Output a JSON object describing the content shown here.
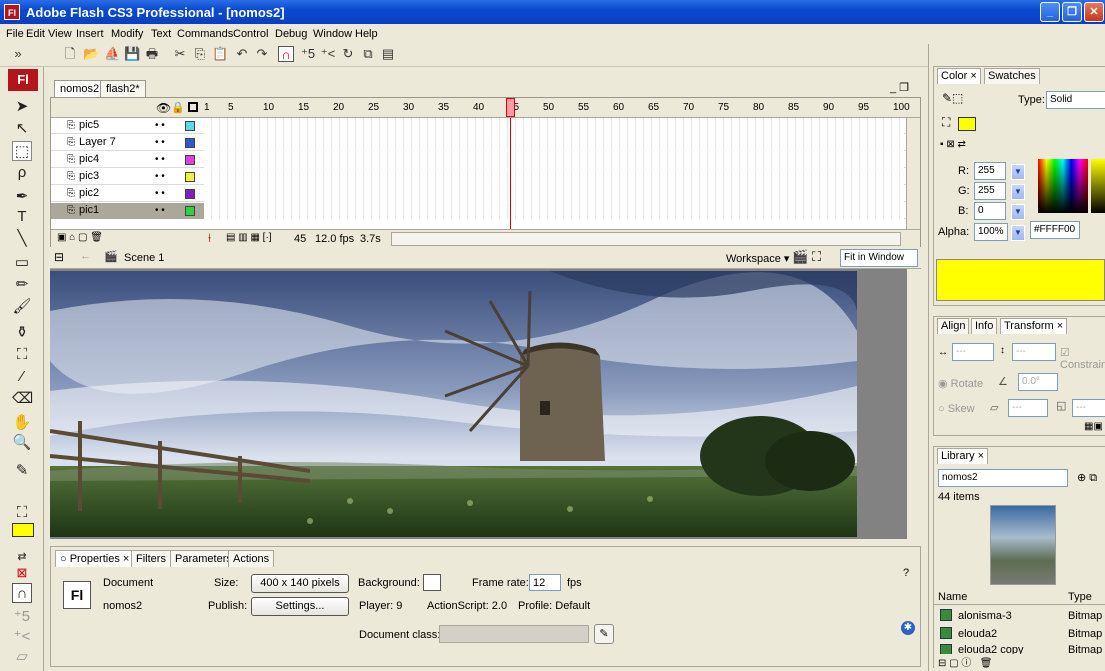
{
  "window": {
    "title": "Adobe Flash CS3 Professional - [nomos2]",
    "app_icon": "Fl"
  },
  "menu": [
    "File",
    "Edit",
    "View",
    "Insert",
    "Modify",
    "Text",
    "Commands",
    "Control",
    "Debug",
    "Window",
    "Help"
  ],
  "tools_logo": "Fl",
  "doc_tabs": [
    "nomos2",
    "flash2*"
  ],
  "timeline": {
    "ruler": [
      "1",
      "5",
      "10",
      "15",
      "20",
      "25",
      "30",
      "35",
      "40",
      "45",
      "50",
      "55",
      "60",
      "65",
      "70",
      "75",
      "80",
      "85",
      "90",
      "95",
      "100"
    ],
    "layers": [
      {
        "name": "pic5",
        "color": "#5fd8e8"
      },
      {
        "name": "Layer 7",
        "color": "#2e5ad0"
      },
      {
        "name": "pic4",
        "color": "#e040e0"
      },
      {
        "name": "pic3",
        "color": "#f0f040"
      },
      {
        "name": "pic2",
        "color": "#8020c0"
      },
      {
        "name": "pic1",
        "color": "#30d040"
      }
    ],
    "current_frame": "45",
    "fps": "12.0 fps",
    "time": "3.7s"
  },
  "editbar": {
    "scene": "Scene 1",
    "workspace": "Workspace ▾",
    "zoom": "Fit in Window"
  },
  "properties": {
    "tabs": [
      "Properties",
      "Filters",
      "Parameters",
      "Actions"
    ],
    "doc_type": "Document",
    "doc_name": "nomos2",
    "logo": "Fl",
    "size_label": "Size:",
    "size_value": "400 x 140 pixels",
    "background_label": "Background:",
    "frame_rate_label": "Frame rate:",
    "frame_rate": "12",
    "fps_unit": "fps",
    "publish_label": "Publish:",
    "settings_button": "Settings...",
    "player": "Player: 9",
    "actionscript": "ActionScript: 2.0",
    "profile": "Profile: Default",
    "doc_class_label": "Document class:"
  },
  "color_panel": {
    "tabs": [
      "Color",
      "Swatches"
    ],
    "type_label": "Type:",
    "type_value": "Solid",
    "r_label": "R:",
    "r": "255",
    "g_label": "G:",
    "g": "255",
    "b_label": "B:",
    "b": "0",
    "alpha_label": "Alpha:",
    "alpha": "100%",
    "hex": "#FFFF00",
    "fill_color": "#FFFF00"
  },
  "transform_panel": {
    "tabs": [
      "Align",
      "Info",
      "Transform"
    ],
    "constrain": "Constrain",
    "rotate": "Rotate",
    "rotate_value": "0.0°",
    "skew": "Skew",
    "dashes": "---"
  },
  "library": {
    "tab": "Library",
    "doc": "nomos2",
    "count": "44 items",
    "col_name": "Name",
    "col_type": "Type",
    "items": [
      {
        "name": "alonisma-3",
        "type": "Bitmap"
      },
      {
        "name": "elouda2",
        "type": "Bitmap"
      },
      {
        "name": "elouda2 copy",
        "type": "Bitmap"
      }
    ]
  }
}
